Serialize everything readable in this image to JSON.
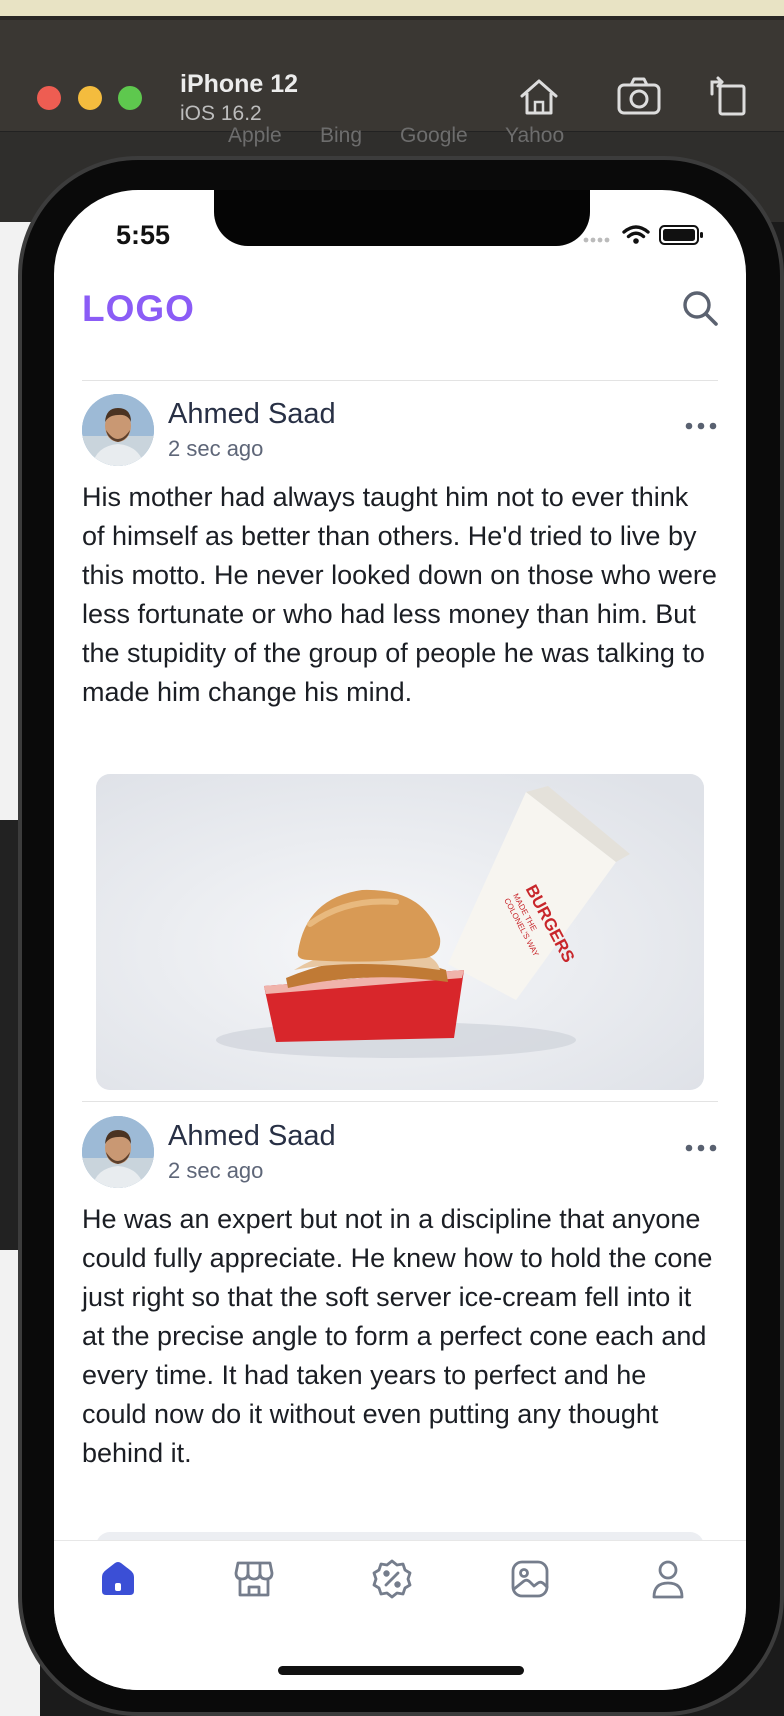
{
  "simulator": {
    "device_name": "iPhone 12",
    "os_version": "iOS 16.2",
    "toolbar_icons": [
      "home-icon",
      "camera-icon",
      "rotate-icon"
    ]
  },
  "background": {
    "bookmarks": [
      "Apple",
      "Bing",
      "Google",
      "Yahoo"
    ]
  },
  "status_bar": {
    "time": "5:55"
  },
  "app": {
    "logo": "LOGO",
    "accent_color": "#8b5cf6",
    "active_tab_color": "#3b4fd6"
  },
  "feed": {
    "posts": [
      {
        "author": "Ahmed Saad",
        "time_ago": "2 sec ago",
        "text": "His mother had always taught him not to ever think of himself as better than others. He'd tried to live by this motto. He never looked down on those who were less fortunate or who had less money than him. But the stupidity of the group of people he was talking to made him change his mind.",
        "image": "burger-photo",
        "image_caption_on_box": "BURGERS MADE THE COLONEL'S WAY"
      },
      {
        "author": "Ahmed Saad",
        "time_ago": "2 sec ago",
        "text": "He was an expert but not in a discipline that anyone could fully appreciate. He knew how to hold the cone just right so that the soft server ice-cream fell into it at the precise angle to form a perfect cone each and every time. It had taken years to perfect and he could now do it without even putting any thought behind it."
      }
    ]
  },
  "tabbar": {
    "tabs": [
      {
        "icon": "home-icon",
        "active": true
      },
      {
        "icon": "store-icon",
        "active": false
      },
      {
        "icon": "discount-badge-icon",
        "active": false
      },
      {
        "icon": "gallery-icon",
        "active": false
      },
      {
        "icon": "profile-icon",
        "active": false
      }
    ]
  }
}
